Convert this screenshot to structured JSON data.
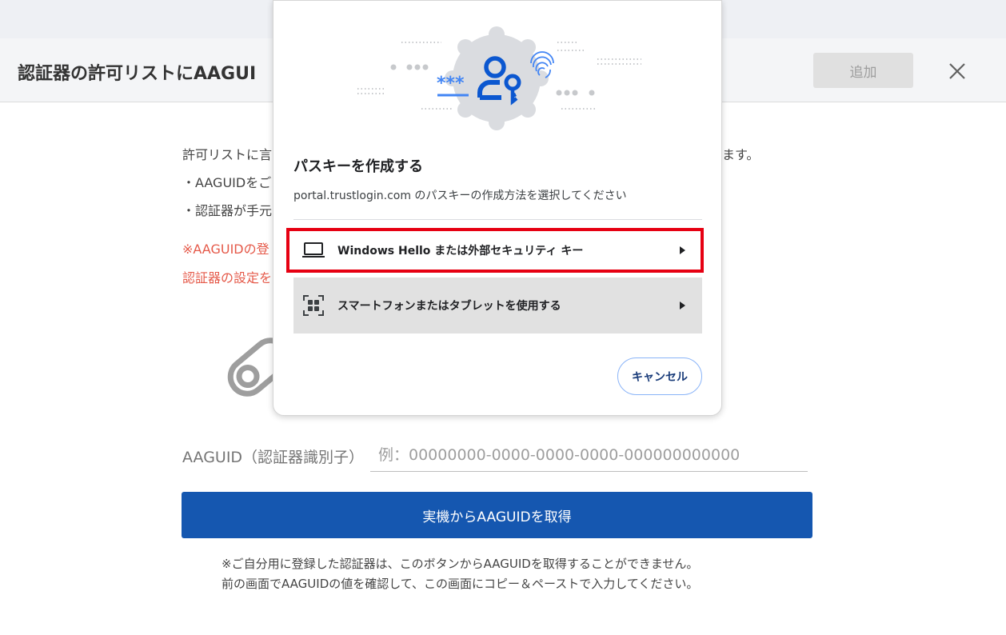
{
  "header": {
    "title": "認証器の許可リストにAAGUI",
    "add_label": "追加"
  },
  "content": {
    "lines": [
      "許可リストに言",
      "・AAGUIDをご",
      "・認証器が手元"
    ],
    "right_fragment": "ます。",
    "warnings": [
      "※AAGUIDの登",
      "認証器の設定を"
    ]
  },
  "form": {
    "aaguid_label": "AAGUID（認証器識別子）",
    "aaguid_placeholder": "例：00000000-0000-0000-0000-000000000000",
    "fetch_button_label": "実機からAAGUIDを取得"
  },
  "notes": [
    "※ご自分用に登録した認証器は、このボタンからAAGUIDを取得することができません。",
    "前の画面でAAGUIDの値を確認して、この画面にコピー＆ペーストで入力してください。"
  ],
  "dialog": {
    "title": "パスキーを作成する",
    "subtitle": "portal.trustlogin.com のパスキーの作成方法を選択してください",
    "hero_text": "***",
    "options": [
      {
        "label": "Windows Hello または外部セキュリティ キー",
        "icon": "laptop-icon"
      },
      {
        "label": "スマートフォンまたはタブレットを使用する",
        "icon": "qr-code-icon"
      }
    ],
    "cancel_label": "キャンセル"
  },
  "colors": {
    "primary": "#1557b0",
    "warning_text": "#e55a4a",
    "highlight": "#e60012",
    "dialog_accent": "#1a73e8"
  }
}
